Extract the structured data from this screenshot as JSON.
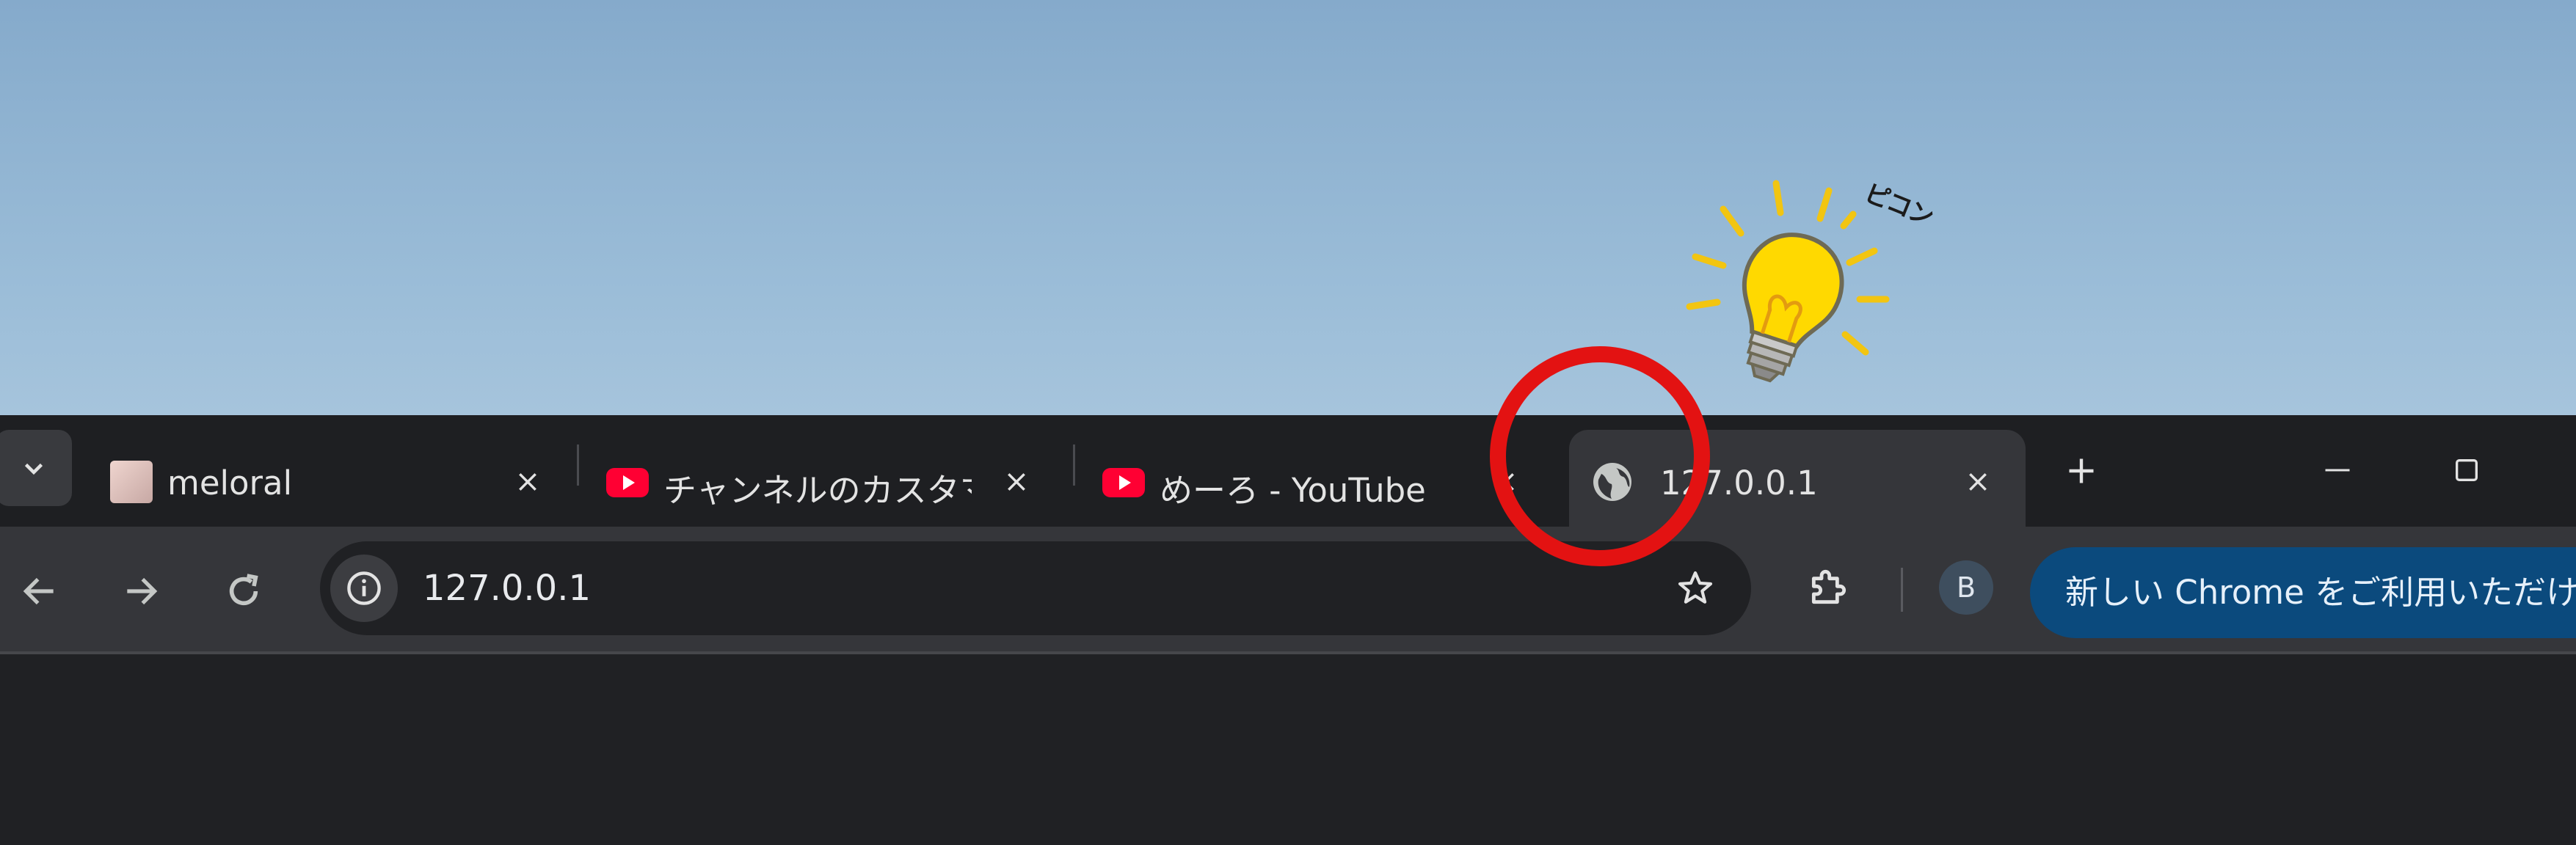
{
  "tabs": [
    {
      "title": "meloral",
      "favicon": "avatar-favicon"
    },
    {
      "title": "チャンネルのカスタマイズ",
      "favicon": "youtube-favicon"
    },
    {
      "title": "めーろ - YouTube",
      "favicon": "youtube-favicon"
    },
    {
      "title": "127.0.0.1",
      "favicon": "globe-favicon",
      "active": true
    }
  ],
  "omnibox": {
    "url": "127.0.0.1"
  },
  "profile": {
    "initial": "B"
  },
  "update_button": {
    "label": "新しい Chrome をご利用いただけます"
  },
  "overlay": {
    "sound_text": "ピコン"
  },
  "colors": {
    "accent_red": "#e31212",
    "youtube_red": "#ff0033",
    "update_blue": "#0b4a7d",
    "bulb_yellow": "#ffd700"
  }
}
